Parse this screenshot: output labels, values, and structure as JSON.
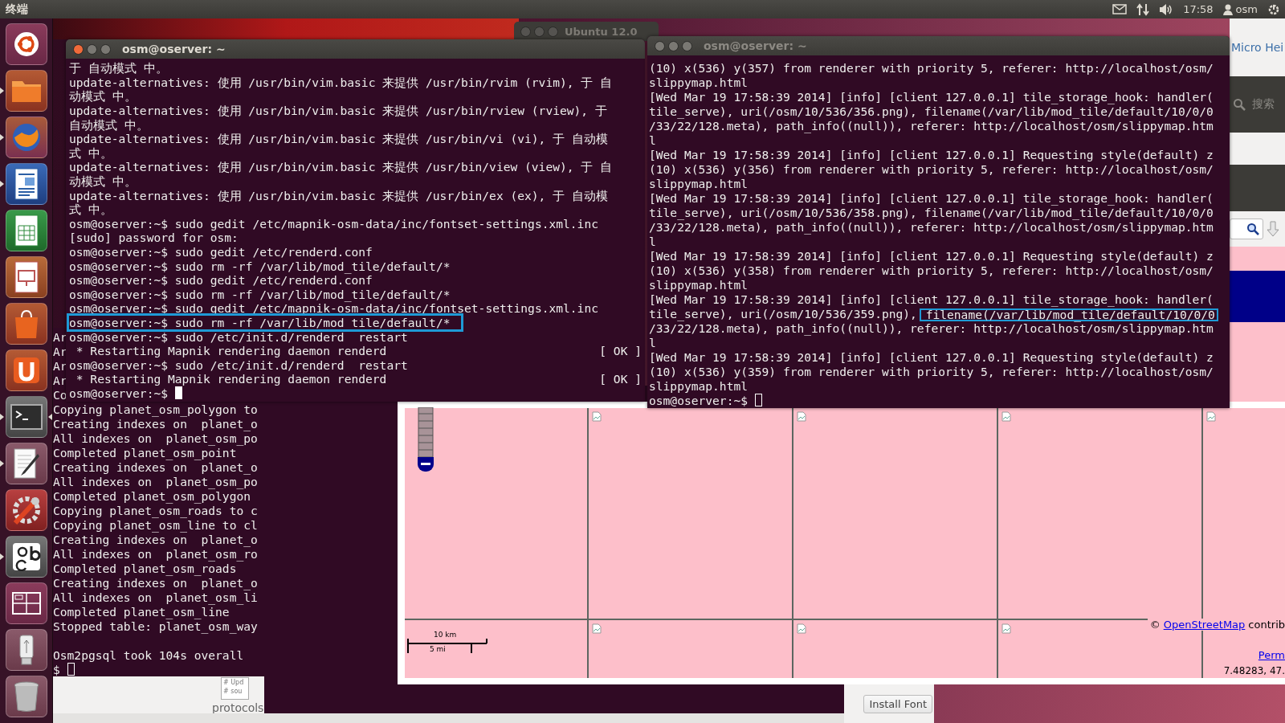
{
  "top_bar": {
    "app_title": "终端",
    "clock": "17:58",
    "user": "osm"
  },
  "launcher": [
    {
      "kind": "dash",
      "running": false,
      "focused": false
    },
    {
      "kind": "files",
      "running": true,
      "focused": false
    },
    {
      "kind": "browser",
      "running": true,
      "focused": false
    },
    {
      "kind": "writer",
      "running": true,
      "focused": false
    },
    {
      "kind": "calc",
      "running": false,
      "focused": false
    },
    {
      "kind": "impress",
      "running": false,
      "focused": false
    },
    {
      "kind": "software",
      "running": false,
      "focused": false
    },
    {
      "kind": "cloud",
      "running": false,
      "focused": false
    },
    {
      "kind": "terminal",
      "running": true,
      "focused": true
    },
    {
      "kind": "editor",
      "running": true,
      "focused": false
    },
    {
      "kind": "settings",
      "running": false,
      "focused": false
    },
    {
      "kind": "fonts",
      "running": true,
      "focused": false
    },
    {
      "kind": "workspaces",
      "running": false,
      "focused": false
    },
    {
      "kind": "usb",
      "running": false,
      "focused": false
    },
    {
      "kind": "trash",
      "running": false,
      "focused": false
    }
  ],
  "back_window": {
    "title": "Ubuntu 12.0"
  },
  "main_terminal": {
    "title": "osm@oserver: ~",
    "active": true,
    "prompt": "osm@oserver:~$ ",
    "lines": [
      {
        "text": "于 自动模式 中。",
        "highlighted": false
      },
      {
        "text": "update-alternatives: 使用 /usr/bin/vim.basic 来提供 /usr/bin/rvim (rvim), 于 自",
        "highlighted": false
      },
      {
        "text": "动模式 中。",
        "highlighted": false
      },
      {
        "text": "update-alternatives: 使用 /usr/bin/vim.basic 来提供 /usr/bin/rview (rview), 于",
        "highlighted": false
      },
      {
        "text": "自动模式 中。",
        "highlighted": false
      },
      {
        "text": "update-alternatives: 使用 /usr/bin/vim.basic 来提供 /usr/bin/vi (vi), 于 自动模",
        "highlighted": false
      },
      {
        "text": "式 中。",
        "highlighted": false
      },
      {
        "text": "update-alternatives: 使用 /usr/bin/vim.basic 来提供 /usr/bin/view (view), 于 自",
        "highlighted": false
      },
      {
        "text": "动模式 中。",
        "highlighted": false
      },
      {
        "text": "update-alternatives: 使用 /usr/bin/vim.basic 来提供 /usr/bin/ex (ex), 于 自动模",
        "highlighted": false
      },
      {
        "text": "式 中。",
        "highlighted": false
      },
      {
        "text": "osm@oserver:~$ sudo gedit /etc/mapnik-osm-data/inc/fontset-settings.xml.inc",
        "highlighted": false
      },
      {
        "text": "[sudo] password for osm:",
        "highlighted": false
      },
      {
        "text": "osm@oserver:~$ sudo gedit /etc/renderd.conf",
        "highlighted": false
      },
      {
        "text": "osm@oserver:~$ sudo rm -rf /var/lib/mod_tile/default/*",
        "highlighted": false
      },
      {
        "text": "osm@oserver:~$ sudo gedit /etc/renderd.conf",
        "highlighted": false
      },
      {
        "text": "osm@oserver:~$ sudo rm -rf /var/lib/mod_tile/default/*",
        "highlighted": false
      },
      {
        "text": "osm@oserver:~$ sudo gedit /etc/mapnik-osm-data/inc/fontset-settings.xml.inc",
        "highlighted": false
      },
      {
        "text": "osm@oserver:~$ sudo rm -rf /var/lib/mod_tile/default/*",
        "highlighted": true
      },
      {
        "text": "osm@oserver:~$ sudo /etc/init.d/renderd  restart",
        "highlighted": false
      },
      {
        "text": " * Restarting Mapnik rendering daemon renderd",
        "status": "[ OK ]",
        "highlighted": false
      },
      {
        "text": "osm@oserver:~$ sudo /etc/init.d/renderd  restart",
        "highlighted": false
      },
      {
        "text": " * Restarting Mapnik rendering daemon renderd",
        "status": "[ OK ]",
        "highlighted": false
      }
    ]
  },
  "log_terminal": {
    "title": "osm@oserver: ~",
    "active": false,
    "prompt": "osm@oserver:~$ ",
    "lines": [
      {
        "text": "(10) x(536) y(357) from renderer with priority 5, referer: http://localhost/osm/"
      },
      {
        "text": "slippymap.html"
      },
      {
        "text": "[Wed Mar 19 17:58:39 2014] [info] [client 127.0.0.1] tile_storage_hook: handler("
      },
      {
        "text": "tile_serve), uri(/osm/10/536/356.png), filename(/var/lib/mod_tile/default/10/0/0"
      },
      {
        "text": "/33/22/128.meta), path_info((null)), referer: http://localhost/osm/slippymap.htm"
      },
      {
        "text": "l"
      },
      {
        "text": "[Wed Mar 19 17:58:39 2014] [info] [client 127.0.0.1] Requesting style(default) z"
      },
      {
        "text": "(10) x(536) y(356) from renderer with priority 5, referer: http://localhost/osm/"
      },
      {
        "text": "slippymap.html"
      },
      {
        "text": "[Wed Mar 19 17:58:39 2014] [info] [client 127.0.0.1] tile_storage_hook: handler("
      },
      {
        "text": "tile_serve), uri(/osm/10/536/358.png), filename(/var/lib/mod_tile/default/10/0/0"
      },
      {
        "text": "/33/22/128.meta), path_info((null)), referer: http://localhost/osm/slippymap.htm"
      },
      {
        "text": "l"
      },
      {
        "text": "[Wed Mar 19 17:58:39 2014] [info] [client 127.0.0.1] Requesting style(default) z"
      },
      {
        "text": "(10) x(536) y(358) from renderer with priority 5, referer: http://localhost/osm/"
      },
      {
        "text": "slippymap.html"
      },
      {
        "text": "[Wed Mar 19 17:58:39 2014] [info] [client 127.0.0.1] tile_storage_hook: handler("
      },
      {
        "text": "tile_serve), uri(/osm/10/536/359.png), ",
        "boxed": "filename(/var/lib/mod_tile/default/10/0/0"
      },
      {
        "text": "/33/22/128.meta), path_info((null)), referer: http://localhost/osm/slippymap.htm"
      },
      {
        "text": "l"
      },
      {
        "text": "[Wed Mar 19 17:58:39 2014] [info] [client 127.0.0.1] Requesting style(default) z"
      },
      {
        "text": "(10) x(536) y(359) from renderer with priority 5, referer: http://localhost/osm/"
      },
      {
        "text": "slippymap.html"
      }
    ]
  },
  "background_terminal": {
    "prompt": "$ ",
    "active": false,
    "summary": "Osm2pgsql took 104s overall",
    "lines": [
      "Ar",
      "Ar",
      "Ar",
      "Ar",
      "Co",
      "Copying planet_osm_polygon to",
      "Creating indexes on  planet_o",
      "All indexes on  planet_osm_po",
      "Completed planet_osm_point",
      "Creating indexes on  planet_o",
      "All indexes on  planet_osm_po",
      "Completed planet_osm_polygon",
      "Copying planet_osm_roads to c",
      "Copying planet_osm_line to cl",
      "Creating indexes on  planet_o",
      "All indexes on  planet_osm_ro",
      "Completed planet_osm_roads",
      "Creating indexes on  planet_o",
      "All indexes on  planet_osm_li",
      "Completed planet_osm_line",
      "Stopped table: planet_osm_way"
    ]
  },
  "map": {
    "scale_km": "10 km",
    "scale_mi": "5 mi",
    "attribution_prefix": "©",
    "attribution_link": "OpenStreetMap",
    "attribution_suffix": "contrib",
    "permalink": "Perm",
    "coordinates": "7.48283, 47."
  },
  "font_viewer": {
    "font_name": "Micro Hei",
    "search_placeholder": "搜索",
    "install_button": "Install Font"
  },
  "editor": {
    "thumbnail_lines": [
      "# Upd",
      "# sou"
    ],
    "file_label": "protocols"
  }
}
